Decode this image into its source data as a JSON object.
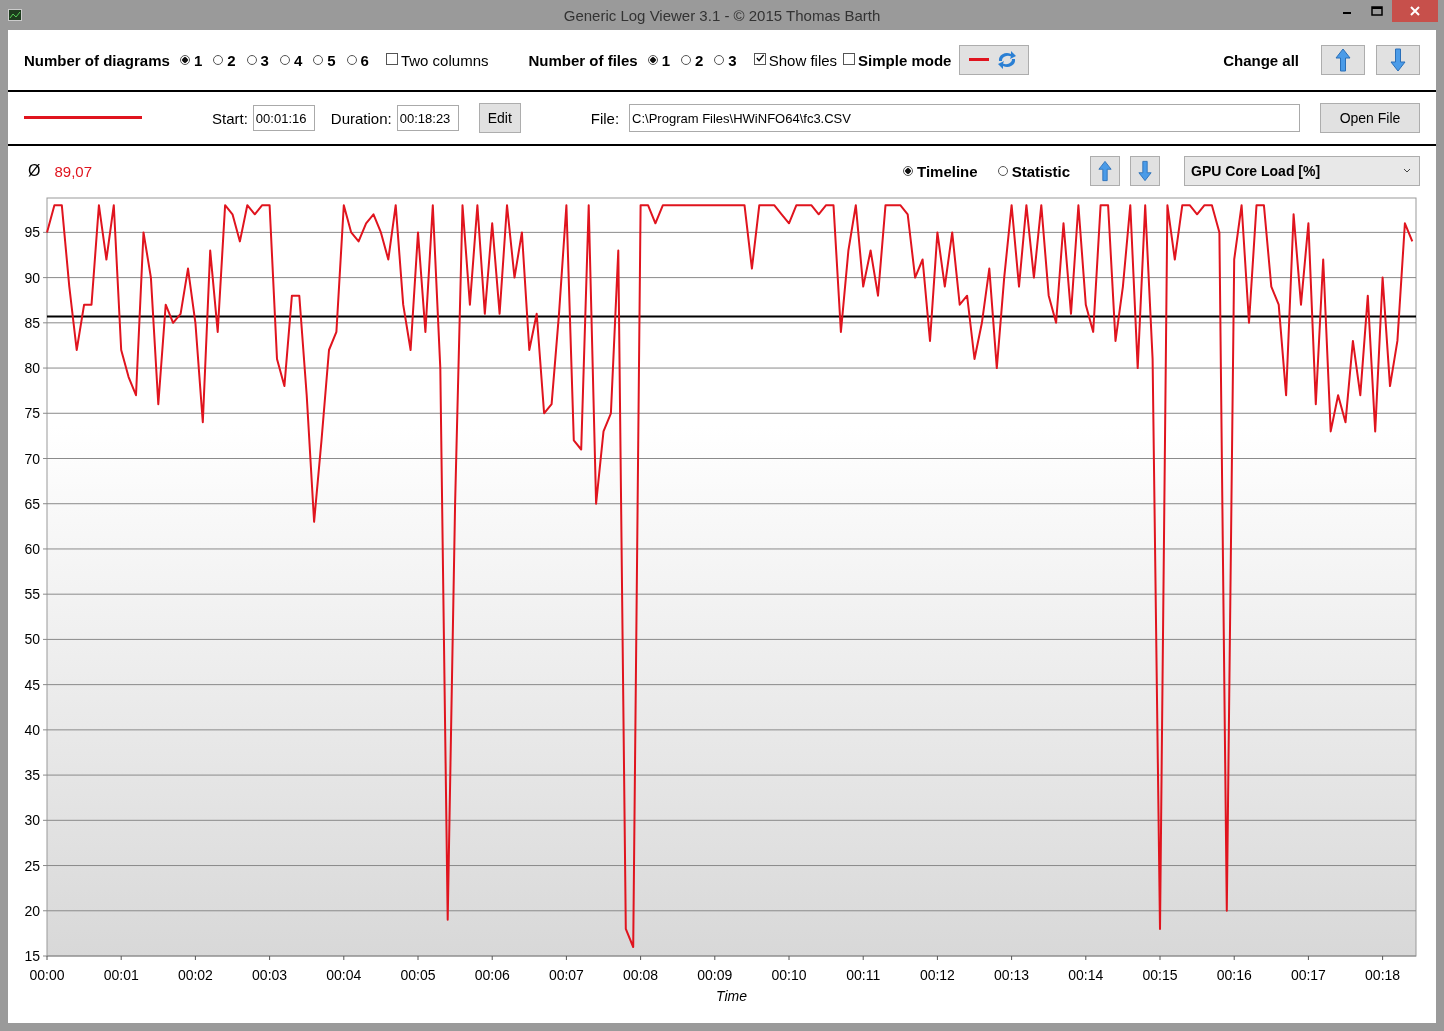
{
  "window": {
    "title": "Generic Log Viewer 3.1 - © 2015 Thomas Barth"
  },
  "toolbar": {
    "diagrams": {
      "label": "Number of diagrams",
      "options": [
        {
          "label": "1",
          "selected": true
        },
        {
          "label": "2",
          "selected": false
        },
        {
          "label": "3",
          "selected": false
        },
        {
          "label": "4",
          "selected": false
        },
        {
          "label": "5",
          "selected": false
        },
        {
          "label": "6",
          "selected": false
        }
      ]
    },
    "two_columns": {
      "label": "Two columns",
      "checked": false
    },
    "files": {
      "label": "Number of files",
      "options": [
        {
          "label": "1",
          "selected": true
        },
        {
          "label": "2",
          "selected": false
        },
        {
          "label": "3",
          "selected": false
        }
      ]
    },
    "show_files": {
      "label": "Show files",
      "checked": true
    },
    "simple_mode": {
      "label": "Simple mode",
      "checked": false
    },
    "change_all": "Change all"
  },
  "file_row": {
    "start_label": "Start:",
    "start": "00:01:16",
    "duration_label": "Duration:",
    "duration": "00:18:23",
    "edit_button": "Edit",
    "file_label": "File:",
    "file": "C:\\Program Files\\HWiNFO64\\fc3.CSV",
    "open_button": "Open File"
  },
  "diagram": {
    "average_symbol": "Ø",
    "average": "89,07",
    "views": [
      {
        "label": "Timeline",
        "selected": true
      },
      {
        "label": "Statistic",
        "selected": false
      }
    ],
    "channel": "GPU Core Load [%]",
    "chart_data": {
      "type": "line",
      "xlabel": "Time",
      "ylim": [
        15,
        98.8
      ],
      "xlim": [
        0,
        18.45
      ],
      "yticks": [
        15,
        20,
        25,
        30,
        35,
        40,
        45,
        50,
        55,
        60,
        65,
        70,
        75,
        80,
        85,
        90,
        95
      ],
      "xticks": [
        {
          "value": 0,
          "label": "00:00"
        },
        {
          "value": 1,
          "label": "00:01"
        },
        {
          "value": 2,
          "label": "00:02"
        },
        {
          "value": 3,
          "label": "00:03"
        },
        {
          "value": 4,
          "label": "00:04"
        },
        {
          "value": 5,
          "label": "00:05"
        },
        {
          "value": 6,
          "label": "00:06"
        },
        {
          "value": 7,
          "label": "00:07"
        },
        {
          "value": 8,
          "label": "00:08"
        },
        {
          "value": 9,
          "label": "00:09"
        },
        {
          "value": 10,
          "label": "00:10"
        },
        {
          "value": 11,
          "label": "00:11"
        },
        {
          "value": 12,
          "label": "00:12"
        },
        {
          "value": 13,
          "label": "00:13"
        },
        {
          "value": 14,
          "label": "00:14"
        },
        {
          "value": 15,
          "label": "00:15"
        },
        {
          "value": 16,
          "label": "00:16"
        },
        {
          "value": 17,
          "label": "00:17"
        },
        {
          "value": 18,
          "label": "00:18"
        }
      ],
      "x": [
        0,
        0.1,
        0.2,
        0.3,
        0.4,
        0.5,
        0.6,
        0.7,
        0.8,
        0.9,
        1,
        1.1,
        1.2,
        1.3,
        1.4,
        1.5,
        1.6,
        1.7,
        1.8,
        1.9,
        2,
        2.1,
        2.2,
        2.3,
        2.4,
        2.5,
        2.6,
        2.7,
        2.8,
        2.9,
        3,
        3.1,
        3.2,
        3.3,
        3.4,
        3.5,
        3.6,
        3.7,
        3.8,
        3.9,
        4,
        4.1,
        4.2,
        4.3,
        4.4,
        4.5,
        4.6,
        4.7,
        4.8,
        4.9,
        5,
        5.1,
        5.2,
        5.3,
        5.4,
        5.5,
        5.6,
        5.7,
        5.8,
        5.9,
        6,
        6.1,
        6.2,
        6.3,
        6.4,
        6.5,
        6.6,
        6.7,
        6.8,
        6.9,
        7,
        7.1,
        7.2,
        7.3,
        7.4,
        7.5,
        7.6,
        7.7,
        7.8,
        7.9,
        8,
        8.1,
        8.2,
        8.3,
        8.4,
        8.5,
        8.6,
        8.7,
        8.8,
        8.9,
        9,
        9.1,
        9.2,
        9.3,
        9.4,
        9.5,
        9.6,
        9.7,
        9.8,
        9.9,
        10,
        10.1,
        10.2,
        10.3,
        10.4,
        10.5,
        10.6,
        10.7,
        10.8,
        10.9,
        11,
        11.1,
        11.2,
        11.3,
        11.4,
        11.5,
        11.6,
        11.7,
        11.8,
        11.9,
        12,
        12.1,
        12.2,
        12.3,
        12.4,
        12.5,
        12.6,
        12.7,
        12.8,
        12.9,
        13,
        13.1,
        13.2,
        13.3,
        13.4,
        13.5,
        13.6,
        13.7,
        13.8,
        13.9,
        14,
        14.1,
        14.2,
        14.3,
        14.4,
        14.5,
        14.6,
        14.7,
        14.8,
        14.9,
        15,
        15.1,
        15.2,
        15.3,
        15.4,
        15.5,
        15.6,
        15.7,
        15.8,
        15.9,
        16,
        16.1,
        16.2,
        16.3,
        16.4,
        16.5,
        16.6,
        16.7,
        16.8,
        16.9,
        17,
        17.1,
        17.2,
        17.3,
        17.4,
        17.5,
        17.6,
        17.7,
        17.8,
        17.9,
        18,
        18.1,
        18.2,
        18.3,
        18.4
      ],
      "series": [
        {
          "color": "#e0141e",
          "values": [
            95,
            98,
            98,
            89,
            82,
            87,
            87,
            98,
            92,
            98,
            82,
            79,
            77,
            95,
            90,
            76,
            87,
            85,
            86,
            91,
            85,
            74,
            93,
            84,
            98,
            97,
            94,
            98,
            97,
            98,
            98,
            81,
            78,
            88,
            88,
            77,
            63,
            72,
            82,
            84,
            98,
            95,
            94,
            96,
            97,
            95,
            92,
            98,
            87,
            82,
            95,
            84,
            98,
            80,
            19,
            65,
            98,
            87,
            98,
            86,
            96,
            86,
            98,
            90,
            95,
            82,
            86,
            75,
            76,
            86,
            98,
            72,
            71,
            98,
            65,
            73,
            75,
            93,
            18,
            16,
            98,
            98,
            96,
            98,
            98,
            98,
            98,
            98,
            98,
            98,
            98,
            98,
            98,
            98,
            98,
            91,
            98,
            98,
            98,
            97,
            96,
            98,
            98,
            98,
            97,
            98,
            98,
            84,
            93,
            98,
            89,
            93,
            88,
            98,
            98,
            98,
            97,
            90,
            92,
            83,
            95,
            89,
            95,
            87,
            88,
            81,
            85,
            91,
            80,
            90,
            98,
            89,
            98,
            90,
            98,
            88,
            85,
            96,
            86,
            98,
            87,
            84,
            98,
            98,
            83,
            89,
            98,
            80,
            98,
            81,
            18,
            98,
            92,
            98,
            98,
            97,
            98,
            98,
            95,
            20,
            92,
            98,
            85,
            98,
            98,
            89,
            87,
            77,
            97,
            87,
            96,
            76,
            92,
            73,
            77,
            74,
            83,
            77,
            88,
            73,
            90,
            78,
            83,
            96,
            94
          ]
        }
      ],
      "grid": true,
      "ref_lines": [
        {
          "axis": "y",
          "value": 85.7
        }
      ]
    }
  }
}
